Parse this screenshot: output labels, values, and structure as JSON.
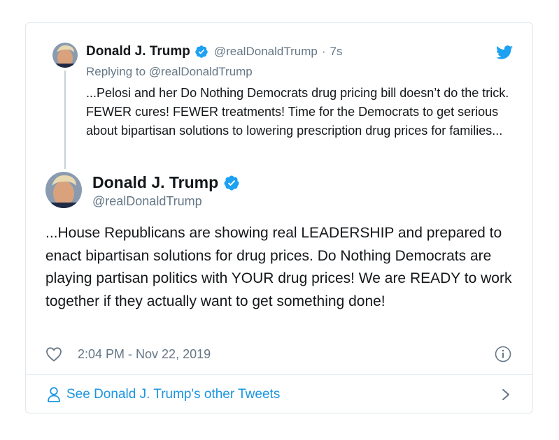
{
  "parent_tweet": {
    "author_name": "Donald J. Trump",
    "handle": "@realDonaldTrump",
    "separator": "·",
    "time_ago": "7s",
    "replying_to_label": "Replying to",
    "replying_to_handle": "@realDonaldTrump",
    "text": "...Pelosi and her Do Nothing Democrats drug pricing bill doesn’t do the trick. FEWER cures! FEWER treatments! Time for the Democrats to get serious about bipartisan solutions to lowering prescription drug prices for families..."
  },
  "main_tweet": {
    "author_name": "Donald J. Trump",
    "handle": "@realDonaldTrump",
    "text": "...House Republicans are showing real LEADERSHIP and prepared to enact bipartisan solutions for drug prices. Do Nothing Democrats are playing partisan politics with YOUR drug prices! We are READY to work together if they actually want to get something done!",
    "timestamp": "2:04 PM - Nov 22, 2019"
  },
  "footer": {
    "link_text": "See Donald J. Trump's other Tweets"
  },
  "colors": {
    "brand_blue": "#1da1f2",
    "link_blue": "#1b95e0",
    "muted": "#657786",
    "text": "#14171a"
  },
  "icons": [
    "twitter-bird-icon",
    "verified-badge-icon",
    "heart-icon",
    "info-icon",
    "person-icon",
    "chevron-right-icon"
  ]
}
